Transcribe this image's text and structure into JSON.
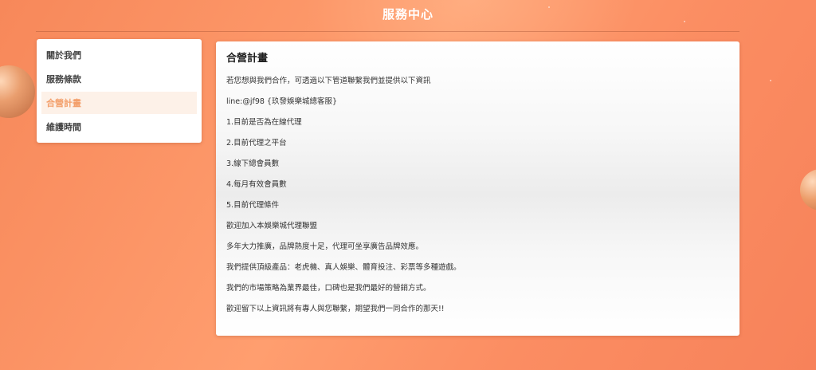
{
  "header": {
    "title": "服務中心"
  },
  "sidebar": {
    "items": [
      {
        "label": "關於我們"
      },
      {
        "label": "服務條款"
      },
      {
        "label": "合營計畫"
      },
      {
        "label": "維護時間"
      }
    ],
    "active_label": "合營計畫"
  },
  "content": {
    "title": "合營計畫",
    "lines": [
      "若您想與我們合作，可透過以下管道聯繫我們並提供以下資訊",
      "line:@jf98 {玖發娛樂城總客服}",
      "1.目前是否為在線代理",
      "2.目前代理之平台",
      "3.線下總會員數",
      "4.每月有效會員數",
      "5.目前代理條件",
      "歡迎加入本娛樂城代理聯盟",
      "多年大力推廣，品牌熱度十足，代理可坐享廣告品牌效應。",
      "我們提供頂級產品：老虎機、真人娛樂、體育投注、彩票等多種遊戲。",
      "我們的市場策略為業界最佳，口碑也是我們最好的營銷方式。",
      "歡迎留下以上資訊將有專人與您聯繫，期望我們一同合作的那天!!"
    ]
  },
  "colors": {
    "background_start": "#f7885a",
    "background_end": "#fb8d62",
    "active_text": "#f3a06c",
    "active_bg": "#fdf1e8",
    "panel": "#ffffff"
  }
}
